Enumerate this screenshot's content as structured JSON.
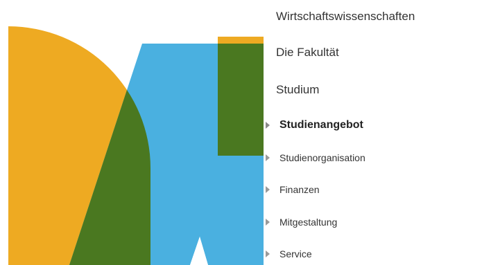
{
  "navigation": {
    "faculty_title": "Wirtschaftswissenschaften",
    "section_faculty": "Die Fakultät",
    "section_studium": "Studium",
    "items": [
      {
        "label": "Studienangebot",
        "active": true
      },
      {
        "label": "Studienorganisation",
        "active": false
      },
      {
        "label": "Finanzen",
        "active": false
      },
      {
        "label": "Mitgestaltung",
        "active": false
      },
      {
        "label": "Service",
        "active": false
      }
    ]
  },
  "colors": {
    "orange": "#eeaa22",
    "blue": "#4ab0e0",
    "green": "#4a7820",
    "text": "#333333"
  }
}
